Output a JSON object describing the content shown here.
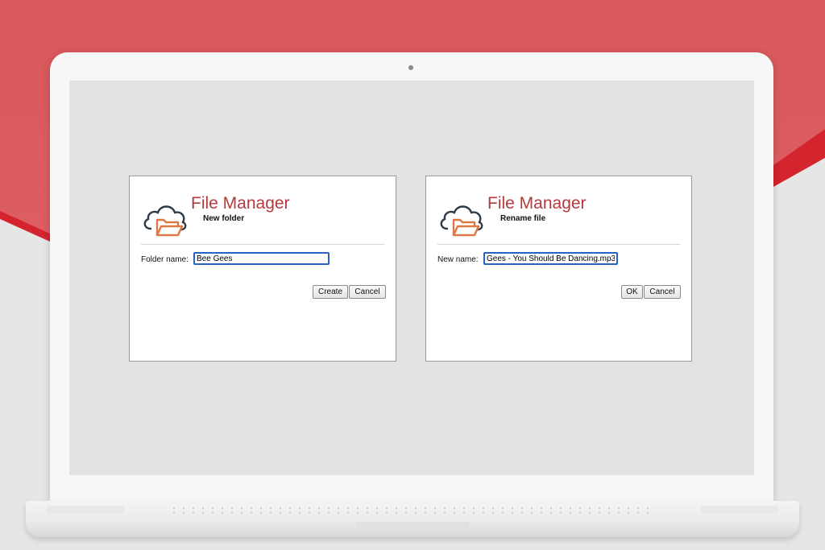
{
  "colors": {
    "brand_title": "#b4393d",
    "logo_cloud": "#2d3a4a",
    "logo_folder": "#e07845",
    "input_focus": "#2a62c4",
    "background_accent": "#d9585c"
  },
  "dialogs": [
    {
      "app_title": "File Manager",
      "subtitle": "New folder",
      "logo_icon": "cloud-folder-icon",
      "field_label": "Folder name:",
      "field_value": "Bee Gees",
      "primary_button": "Create",
      "cancel_button": "Cancel"
    },
    {
      "app_title": "File Manager",
      "subtitle": "Rename file",
      "logo_icon": "cloud-folder-icon",
      "field_label": "New name:",
      "field_value": "Gees - You Should Be Dancing.mp3",
      "primary_button": "OK",
      "cancel_button": "Cancel"
    }
  ]
}
